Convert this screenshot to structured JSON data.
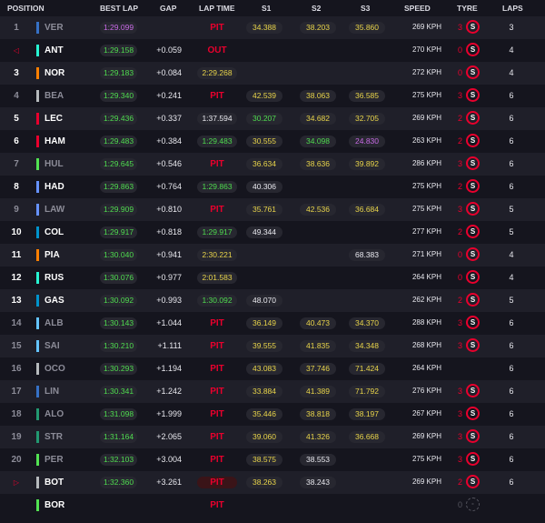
{
  "headers": {
    "position": "POSITION",
    "best_lap": "BEST LAP",
    "gap": "GAP",
    "lap_time": "LAP TIME",
    "s1": "S1",
    "s2": "S2",
    "s3": "S3",
    "speed": "SPEED",
    "tyre": "TYRE",
    "laps": "LAPS"
  },
  "colors": {
    "background": "#15151e",
    "row_alt": "#1f1f29",
    "pill": "#272730",
    "green": "#4fdc4f",
    "yellow": "#e8d44a",
    "purple": "#c86ae6",
    "red": "#e8002d"
  },
  "rows": [
    {
      "pos": "1",
      "pos_style": "dim",
      "team_color": "#3671c6",
      "code": "VER",
      "code_style": "dim",
      "best": "1:29.099",
      "best_style": "purple",
      "gap": "",
      "lap": "PIT",
      "lap_style": "pit",
      "s1": "34.388",
      "s1_style": "yellow",
      "s2": "38.203",
      "s2_style": "yellow",
      "s3": "35.860",
      "s3_style": "yellow",
      "speed": "269 KPH",
      "tyre_laps": "3",
      "tyre": "S",
      "tyre_style": "soft",
      "laps": "3"
    },
    {
      "pos": "",
      "pos_style": "flag",
      "pos_icon": "◁",
      "team_color": "#27f4d2",
      "code": "ANT",
      "code_style": "",
      "best": "1:29.158",
      "best_style": "",
      "gap": "+0.059",
      "lap": "OUT",
      "lap_style": "out",
      "s1": "",
      "s1_style": "",
      "s2": "",
      "s2_style": "",
      "s3": "",
      "s3_style": "",
      "speed": "270 KPH",
      "tyre_laps": "0",
      "tyre": "S",
      "tyre_style": "soft",
      "laps": "4"
    },
    {
      "pos": "3",
      "pos_style": "",
      "team_color": "#ff8000",
      "code": "NOR",
      "code_style": "",
      "best": "1:29.183",
      "best_style": "",
      "gap": "+0.084",
      "lap": "2:29.268",
      "lap_style": "yellow",
      "s1": "",
      "s1_style": "",
      "s2": "",
      "s2_style": "",
      "s3": "",
      "s3_style": "",
      "speed": "272 KPH",
      "tyre_laps": "0",
      "tyre": "S",
      "tyre_style": "soft",
      "laps": "4"
    },
    {
      "pos": "4",
      "pos_style": "dim",
      "team_color": "#b6babd",
      "code": "BEA",
      "code_style": "dim",
      "best": "1:29.340",
      "best_style": "",
      "gap": "+0.241",
      "lap": "PIT",
      "lap_style": "pit",
      "s1": "42.539",
      "s1_style": "yellow",
      "s2": "38.063",
      "s2_style": "yellow",
      "s3": "36.585",
      "s3_style": "yellow",
      "speed": "275 KPH",
      "tyre_laps": "3",
      "tyre": "S",
      "tyre_style": "soft",
      "laps": "6"
    },
    {
      "pos": "5",
      "pos_style": "",
      "team_color": "#e8002d",
      "code": "LEC",
      "code_style": "",
      "best": "1:29.436",
      "best_style": "",
      "gap": "+0.337",
      "lap": "1:37.594",
      "lap_style": "",
      "s1": "30.207",
      "s1_style": "green",
      "s2": "34.682",
      "s2_style": "yellow",
      "s3": "32.705",
      "s3_style": "yellow",
      "speed": "269 KPH",
      "tyre_laps": "2",
      "tyre": "S",
      "tyre_style": "soft",
      "laps": "6"
    },
    {
      "pos": "6",
      "pos_style": "",
      "team_color": "#e8002d",
      "code": "HAM",
      "code_style": "",
      "best": "1:29.483",
      "best_style": "",
      "gap": "+0.384",
      "lap": "1:29.483",
      "lap_style": "green",
      "s1": "30.555",
      "s1_style": "yellow",
      "s2": "34.098",
      "s2_style": "green",
      "s3": "24.830",
      "s3_style": "purple",
      "speed": "263 KPH",
      "tyre_laps": "2",
      "tyre": "S",
      "tyre_style": "soft",
      "laps": "6"
    },
    {
      "pos": "7",
      "pos_style": "dim",
      "team_color": "#52e252",
      "code": "HUL",
      "code_style": "dim",
      "best": "1:29.645",
      "best_style": "",
      "gap": "+0.546",
      "lap": "PIT",
      "lap_style": "pit",
      "s1": "36.634",
      "s1_style": "yellow",
      "s2": "38.636",
      "s2_style": "yellow",
      "s3": "39.892",
      "s3_style": "yellow",
      "speed": "286 KPH",
      "tyre_laps": "3",
      "tyre": "S",
      "tyre_style": "soft",
      "laps": "6"
    },
    {
      "pos": "8",
      "pos_style": "",
      "team_color": "#6692ff",
      "code": "HAD",
      "code_style": "",
      "best": "1:29.863",
      "best_style": "",
      "gap": "+0.764",
      "lap": "1:29.863",
      "lap_style": "green",
      "s1": "40.306",
      "s1_style": "",
      "s2": "",
      "s2_style": "",
      "s3": "",
      "s3_style": "",
      "speed": "275 KPH",
      "tyre_laps": "2",
      "tyre": "S",
      "tyre_style": "soft",
      "laps": "6"
    },
    {
      "pos": "9",
      "pos_style": "dim",
      "team_color": "#6692ff",
      "code": "LAW",
      "code_style": "dim",
      "best": "1:29.909",
      "best_style": "",
      "gap": "+0.810",
      "lap": "PIT",
      "lap_style": "pit",
      "s1": "35.761",
      "s1_style": "yellow",
      "s2": "42.536",
      "s2_style": "yellow",
      "s3": "36.684",
      "s3_style": "yellow",
      "speed": "275 KPH",
      "tyre_laps": "3",
      "tyre": "S",
      "tyre_style": "soft",
      "laps": "5"
    },
    {
      "pos": "10",
      "pos_style": "",
      "team_color": "#0093cc",
      "code": "COL",
      "code_style": "",
      "best": "1:29.917",
      "best_style": "",
      "gap": "+0.818",
      "lap": "1:29.917",
      "lap_style": "green",
      "s1": "49.344",
      "s1_style": "",
      "s2": "",
      "s2_style": "",
      "s3": "",
      "s3_style": "",
      "speed": "277 KPH",
      "tyre_laps": "2",
      "tyre": "S",
      "tyre_style": "soft",
      "laps": "5"
    },
    {
      "pos": "11",
      "pos_style": "",
      "team_color": "#ff8000",
      "code": "PIA",
      "code_style": "",
      "best": "1:30.040",
      "best_style": "",
      "gap": "+0.941",
      "lap": "2:30.221",
      "lap_style": "yellow",
      "s1": "",
      "s1_style": "",
      "s2": "",
      "s2_style": "",
      "s3": "68.383",
      "s3_style": "",
      "speed": "271 KPH",
      "tyre_laps": "0",
      "tyre": "S",
      "tyre_style": "soft",
      "laps": "4"
    },
    {
      "pos": "12",
      "pos_style": "",
      "team_color": "#27f4d2",
      "code": "RUS",
      "code_style": "",
      "best": "1:30.076",
      "best_style": "",
      "gap": "+0.977",
      "lap": "2:01.583",
      "lap_style": "yellow",
      "s1": "",
      "s1_style": "",
      "s2": "",
      "s2_style": "",
      "s3": "",
      "s3_style": "",
      "speed": "264 KPH",
      "tyre_laps": "0",
      "tyre": "S",
      "tyre_style": "soft",
      "laps": "4"
    },
    {
      "pos": "13",
      "pos_style": "",
      "team_color": "#0093cc",
      "code": "GAS",
      "code_style": "",
      "best": "1:30.092",
      "best_style": "",
      "gap": "+0.993",
      "lap": "1:30.092",
      "lap_style": "green",
      "s1": "48.070",
      "s1_style": "",
      "s2": "",
      "s2_style": "",
      "s3": "",
      "s3_style": "",
      "speed": "262 KPH",
      "tyre_laps": "2",
      "tyre": "S",
      "tyre_style": "soft",
      "laps": "5"
    },
    {
      "pos": "14",
      "pos_style": "dim",
      "team_color": "#64c4ff",
      "code": "ALB",
      "code_style": "dim",
      "best": "1:30.143",
      "best_style": "",
      "gap": "+1.044",
      "lap": "PIT",
      "lap_style": "pit",
      "s1": "36.149",
      "s1_style": "yellow",
      "s2": "40.473",
      "s2_style": "yellow",
      "s3": "34.370",
      "s3_style": "yellow",
      "speed": "288 KPH",
      "tyre_laps": "3",
      "tyre": "S",
      "tyre_style": "soft",
      "laps": "6"
    },
    {
      "pos": "15",
      "pos_style": "dim",
      "team_color": "#64c4ff",
      "code": "SAI",
      "code_style": "dim",
      "best": "1:30.210",
      "best_style": "",
      "gap": "+1.111",
      "lap": "PIT",
      "lap_style": "pit",
      "s1": "39.555",
      "s1_style": "yellow",
      "s2": "41.835",
      "s2_style": "yellow",
      "s3": "34.348",
      "s3_style": "yellow",
      "speed": "268 KPH",
      "tyre_laps": "3",
      "tyre": "S",
      "tyre_style": "soft",
      "laps": "6"
    },
    {
      "pos": "16",
      "pos_style": "dim",
      "team_color": "#b6babd",
      "code": "OCO",
      "code_style": "dim",
      "best": "1:30.293",
      "best_style": "",
      "gap": "+1.194",
      "lap": "PIT",
      "lap_style": "pit",
      "s1": "43.083",
      "s1_style": "yellow",
      "s2": "37.746",
      "s2_style": "yellow",
      "s3": "71.424",
      "s3_style": "yellow",
      "speed": "264 KPH",
      "tyre_laps": "",
      "tyre": "",
      "tyre_style": "none",
      "laps": "6"
    },
    {
      "pos": "17",
      "pos_style": "dim",
      "team_color": "#3671c6",
      "code": "LIN",
      "code_style": "dim",
      "best": "1:30.341",
      "best_style": "",
      "gap": "+1.242",
      "lap": "PIT",
      "lap_style": "pit",
      "s1": "33.884",
      "s1_style": "yellow",
      "s2": "41.389",
      "s2_style": "yellow",
      "s3": "71.792",
      "s3_style": "yellow",
      "speed": "276 KPH",
      "tyre_laps": "3",
      "tyre": "S",
      "tyre_style": "soft",
      "laps": "6"
    },
    {
      "pos": "18",
      "pos_style": "dim",
      "team_color": "#229971",
      "code": "ALO",
      "code_style": "dim",
      "best": "1:31.098",
      "best_style": "",
      "gap": "+1.999",
      "lap": "PIT",
      "lap_style": "pit",
      "s1": "35.446",
      "s1_style": "yellow",
      "s2": "38.818",
      "s2_style": "yellow",
      "s3": "38.197",
      "s3_style": "yellow",
      "speed": "267 KPH",
      "tyre_laps": "3",
      "tyre": "S",
      "tyre_style": "soft",
      "laps": "6"
    },
    {
      "pos": "19",
      "pos_style": "dim",
      "team_color": "#229971",
      "code": "STR",
      "code_style": "dim",
      "best": "1:31.164",
      "best_style": "",
      "gap": "+2.065",
      "lap": "PIT",
      "lap_style": "pit",
      "s1": "39.060",
      "s1_style": "yellow",
      "s2": "41.326",
      "s2_style": "yellow",
      "s3": "36.668",
      "s3_style": "yellow",
      "speed": "269 KPH",
      "tyre_laps": "3",
      "tyre": "S",
      "tyre_style": "soft",
      "laps": "6"
    },
    {
      "pos": "20",
      "pos_style": "dim",
      "team_color": "#52e252",
      "code": "PER",
      "code_style": "dim",
      "best": "1:32.103",
      "best_style": "",
      "gap": "+3.004",
      "lap": "PIT",
      "lap_style": "pit",
      "s1": "38.575",
      "s1_style": "yellow",
      "s2": "38.553",
      "s2_style": "",
      "s3": "",
      "s3_style": "",
      "speed": "275 KPH",
      "tyre_laps": "3",
      "tyre": "S",
      "tyre_style": "soft",
      "laps": "6"
    },
    {
      "pos": "",
      "pos_style": "flag",
      "pos_icon": "▷",
      "team_color": "#b6babd",
      "code": "BOT",
      "code_style": "",
      "best": "1:32.360",
      "best_style": "",
      "gap": "+3.261",
      "lap": "PIT",
      "lap_style": "pitbox",
      "s1": "38.263",
      "s1_style": "yellow",
      "s2": "38.243",
      "s2_style": "",
      "s3": "",
      "s3_style": "",
      "speed": "269 KPH",
      "tyre_laps": "2",
      "tyre": "S",
      "tyre_style": "soft",
      "laps": "6"
    },
    {
      "pos": "",
      "pos_style": "",
      "team_color": "#52e252",
      "code": "BOR",
      "code_style": "",
      "best": "",
      "best_style": "",
      "gap": "",
      "lap": "PIT",
      "lap_style": "pit",
      "s1": "",
      "s1_style": "",
      "s2": "",
      "s2_style": "",
      "s3": "",
      "s3_style": "",
      "speed": "",
      "tyre_laps": "0",
      "tyre": "",
      "tyre_style": "unknown",
      "laps": ""
    }
  ]
}
